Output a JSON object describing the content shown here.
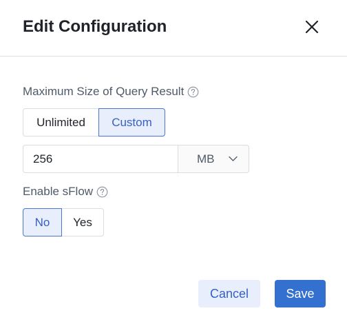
{
  "dialog": {
    "title": "Edit Configuration",
    "close_icon": "close-icon"
  },
  "query_result": {
    "label": "Maximum Size of Query Result",
    "help_icon": "question-circle-icon",
    "options": [
      "Unlimited",
      "Custom"
    ],
    "selected": "Custom",
    "size_value": "256",
    "unit": "MB",
    "unit_icon": "chevron-down-icon"
  },
  "sflow": {
    "label": "Enable sFlow",
    "help_icon": "question-circle-icon",
    "options": [
      "No",
      "Yes"
    ],
    "selected": "No"
  },
  "footer": {
    "cancel_label": "Cancel",
    "save_label": "Save"
  },
  "colors": {
    "accent": "#3470d0",
    "accent_light": "#e8eefc",
    "border": "#d9dce1",
    "text": "#1f2329",
    "muted_text": "#4e5969"
  }
}
